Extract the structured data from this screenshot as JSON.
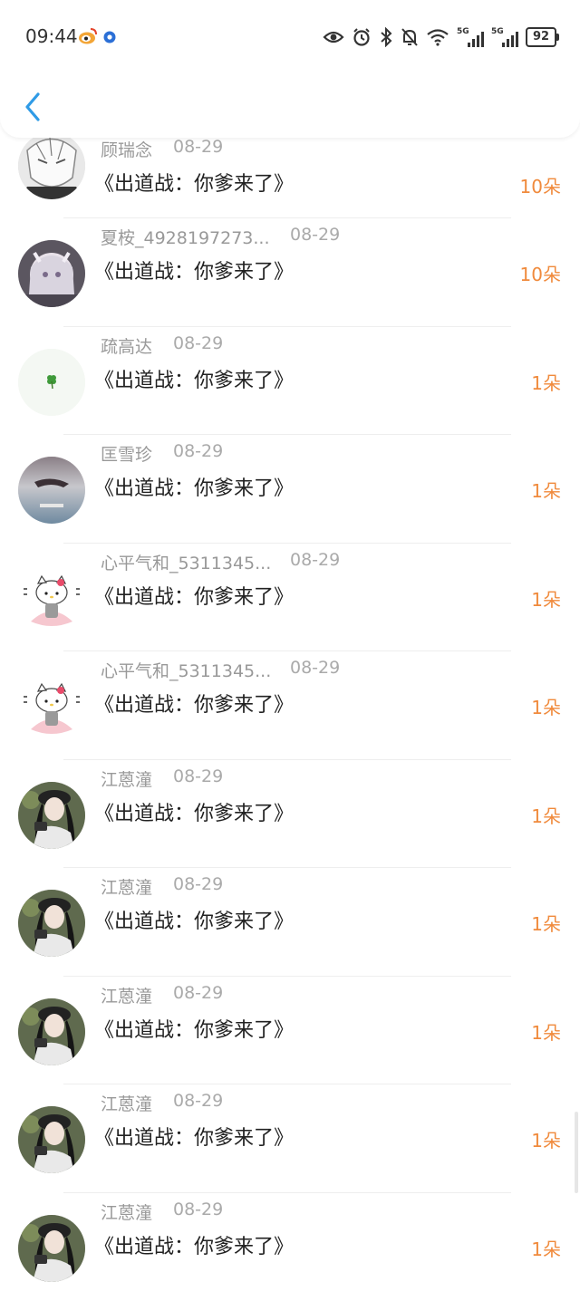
{
  "status_bar": {
    "time": "09:44",
    "battery": "92",
    "signal_1": "5G",
    "signal_2": "5G",
    "icons": [
      "weibo-icon",
      "app-notification-icon",
      "eye-icon",
      "alarm-icon",
      "bluetooth-icon",
      "mute-bell-icon",
      "wifi-icon",
      "signal-icon",
      "signal-icon",
      "battery-icon"
    ]
  },
  "header": {
    "back_icon": "chevron-left-icon"
  },
  "colors": {
    "accent": "#f08a3c",
    "back": "#2f9be6",
    "name": "#999999",
    "date": "#aaaaaa"
  },
  "rows": [
    {
      "name": "顾瑞念",
      "date": "08-29",
      "gift": "《出道战：你爹来了》",
      "count": "10朵",
      "avatar": "anime-sketch-avatar"
    },
    {
      "name": "夏桉_4928197273...",
      "date": "08-29",
      "gift": "《出道战：你爹来了》",
      "count": "10朵",
      "avatar": "anime-girl-avatar"
    },
    {
      "name": "疏高达",
      "date": "08-29",
      "gift": "《出道战：你爹来了》",
      "count": "1朵",
      "avatar": "clover-avatar"
    },
    {
      "name": "匡雪珍",
      "date": "08-29",
      "gift": "《出道战：你爹来了》",
      "count": "1朵",
      "avatar": "underwater-avatar"
    },
    {
      "name": "心平气和_5311345...",
      "date": "08-29",
      "gift": "《出道战：你爹来了》",
      "count": "1朵",
      "avatar": "hello-kitty-avatar"
    },
    {
      "name": "心平气和_5311345...",
      "date": "08-29",
      "gift": "《出道战：你爹来了》",
      "count": "1朵",
      "avatar": "hello-kitty-avatar"
    },
    {
      "name": "江蒽潼",
      "date": "08-29",
      "gift": "《出道战：你爹来了》",
      "count": "1朵",
      "avatar": "girl-photo-avatar"
    },
    {
      "name": "江蒽潼",
      "date": "08-29",
      "gift": "《出道战：你爹来了》",
      "count": "1朵",
      "avatar": "girl-photo-avatar"
    },
    {
      "name": "江蒽潼",
      "date": "08-29",
      "gift": "《出道战：你爹来了》",
      "count": "1朵",
      "avatar": "girl-photo-avatar"
    },
    {
      "name": "江蒽潼",
      "date": "08-29",
      "gift": "《出道战：你爹来了》",
      "count": "1朵",
      "avatar": "girl-photo-avatar"
    },
    {
      "name": "江蒽潼",
      "date": "08-29",
      "gift": "《出道战：你爹来了》",
      "count": "1朵",
      "avatar": "girl-photo-avatar"
    }
  ]
}
